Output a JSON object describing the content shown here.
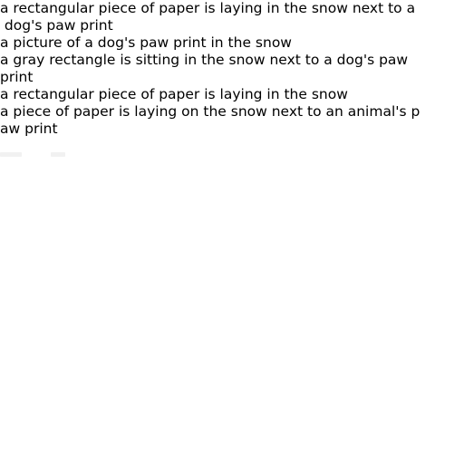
{
  "caption_lines": [
    "a rectangular piece of paper is laying in the snow next to a",
    " dog's paw print",
    "a picture of a dog's paw print in the snow",
    "a gray rectangle is sitting in the snow next to a dog's paw",
    "print",
    "a rectangular piece of paper is laying in the snow",
    "a piece of paper is laying on the snow next to an animal's p",
    "aw print"
  ]
}
